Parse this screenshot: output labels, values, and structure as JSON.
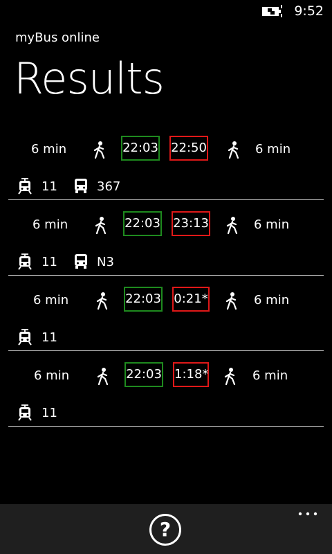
{
  "status_bar": {
    "time": "9:52",
    "battery_icon": "battery-charging-icon"
  },
  "header": {
    "app_title": "myBus online",
    "page_title": "Results"
  },
  "results": [
    {
      "walk_before": "6 min",
      "depart": "22:03",
      "arrive": "22:50",
      "walk_after": "6 min",
      "legs": [
        {
          "mode": "tram-icon",
          "line": "11"
        },
        {
          "mode": "bus-icon",
          "line": "367"
        }
      ]
    },
    {
      "walk_before": "6 min",
      "depart": "22:03",
      "arrive": "23:13",
      "walk_after": "6 min",
      "legs": [
        {
          "mode": "tram-icon",
          "line": "11"
        },
        {
          "mode": "bus-icon",
          "line": "N3"
        }
      ]
    },
    {
      "walk_before": "6 min",
      "depart": "22:03",
      "arrive": "0:21*",
      "walk_after": "6 min",
      "legs": [
        {
          "mode": "tram-icon",
          "line": "11"
        }
      ]
    },
    {
      "walk_before": "6 min",
      "depart": "22:03",
      "arrive": "1:18*",
      "walk_after": "6 min",
      "legs": [
        {
          "mode": "tram-icon",
          "line": "11"
        }
      ]
    }
  ],
  "app_bar": {
    "help_label": "?",
    "help_icon": "help-icon",
    "more_icon": "more-icon"
  },
  "colors": {
    "background": "#000000",
    "app_bar": "#1f1f1f",
    "depart_border": "#1e8a1e",
    "arrive_border": "#e01818"
  }
}
